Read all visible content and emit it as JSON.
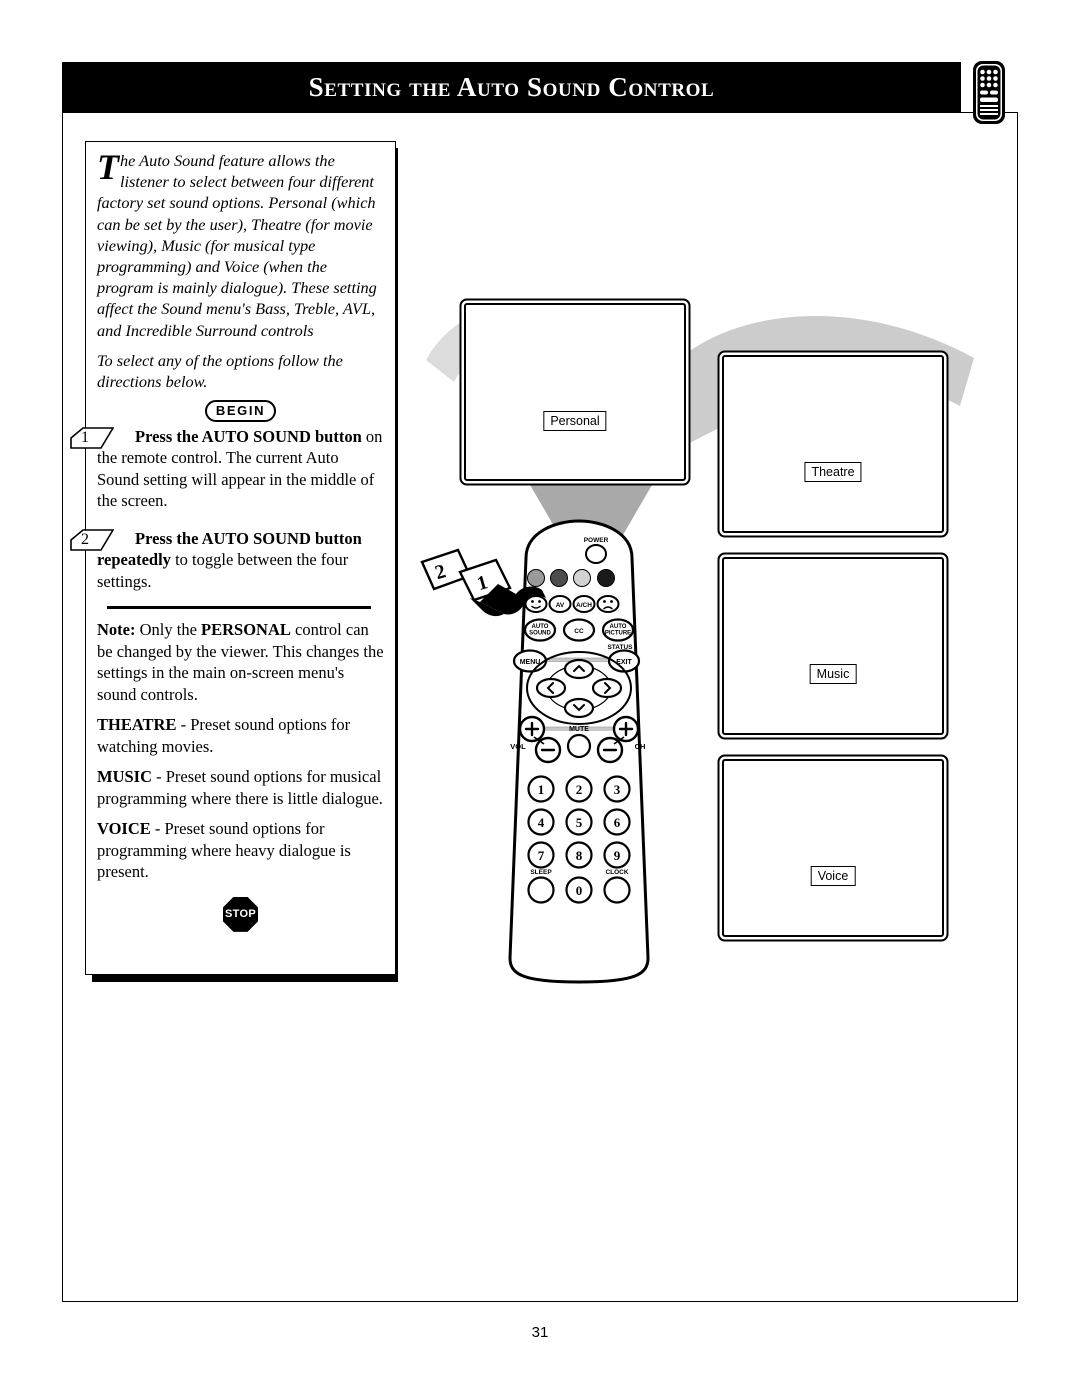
{
  "header": {
    "title": "Setting the Auto Sound Control",
    "remote_icon": "remote-control-icon"
  },
  "instructions": {
    "intro_dropcap": "T",
    "intro_paragraph": "he Auto Sound feature allows the listener to select between four different factory set sound options. Personal (which can be set by the user), Theatre (for movie viewing), Music (for musical type programming) and Voice (when the program is mainly dialogue). These setting affect the Sound menu's Bass, Treble, AVL, and Incredible Surround controls",
    "intro_paragraph2": "To select any of the options follow the directions below.",
    "begin_badge": "BEGIN",
    "stop_badge": "STOP",
    "steps": [
      {
        "number": "1",
        "bold": "Press the AUTO  SOUND button",
        "rest": " on the remote control. The current Auto Sound setting will appear in the middle of the screen."
      },
      {
        "number": "2",
        "bold": "Press the AUTO  SOUND button",
        "bold2": "repeatedly",
        "rest": " to toggle between the four settings."
      }
    ],
    "note": {
      "label": "Note:",
      "text_before": " Only the ",
      "bold": "PERSONAL",
      "text_after": " control can be changed by the viewer. This changes the settings in the main on-screen menu's sound controls."
    },
    "definitions": [
      {
        "term": "THEATRE",
        "text": " - Preset sound options for watching movies."
      },
      {
        "term": "MUSIC",
        "text": " - Preset sound options for musical programming where there is little dialogue."
      },
      {
        "term": "VOICE",
        "text": " - Preset sound options for programming where heavy dialogue is present."
      }
    ]
  },
  "screens": [
    {
      "id": "personal",
      "osd_label": "Personal"
    },
    {
      "id": "theatre",
      "osd_label": "Theatre"
    },
    {
      "id": "music",
      "osd_label": "Music"
    },
    {
      "id": "voice",
      "osd_label": "Voice"
    }
  ],
  "remote": {
    "power_label": "POWER",
    "color_buttons": [
      "#9a9a9a",
      "#4c4c4c",
      "#d2d2d2",
      "#1a1a1a"
    ],
    "icon_row": [
      "smiley-face-icon",
      "AV",
      "A/CH",
      "sad-face-icon"
    ],
    "function_row": [
      "AUTO SOUND",
      "CC",
      "AUTO PICTURE"
    ],
    "status_label": "STATUS",
    "menu_label": "MENU",
    "exit_label": "EXIT",
    "mute_label": "MUTE",
    "vol_label": "VOL",
    "ch_label": "CH",
    "sleep_label": "SLEEP",
    "clock_label": "CLOCK",
    "keypad": [
      "1",
      "2",
      "3",
      "4",
      "5",
      "6",
      "7",
      "8",
      "9",
      "0"
    ]
  },
  "callouts": {
    "tag_2": "2",
    "tag_1": "1"
  },
  "footer": {
    "page_number": "31"
  },
  "colors": {
    "header_bg": "#000000",
    "header_text": "#ffffff",
    "swoosh_gray": "#c9c9c9"
  }
}
